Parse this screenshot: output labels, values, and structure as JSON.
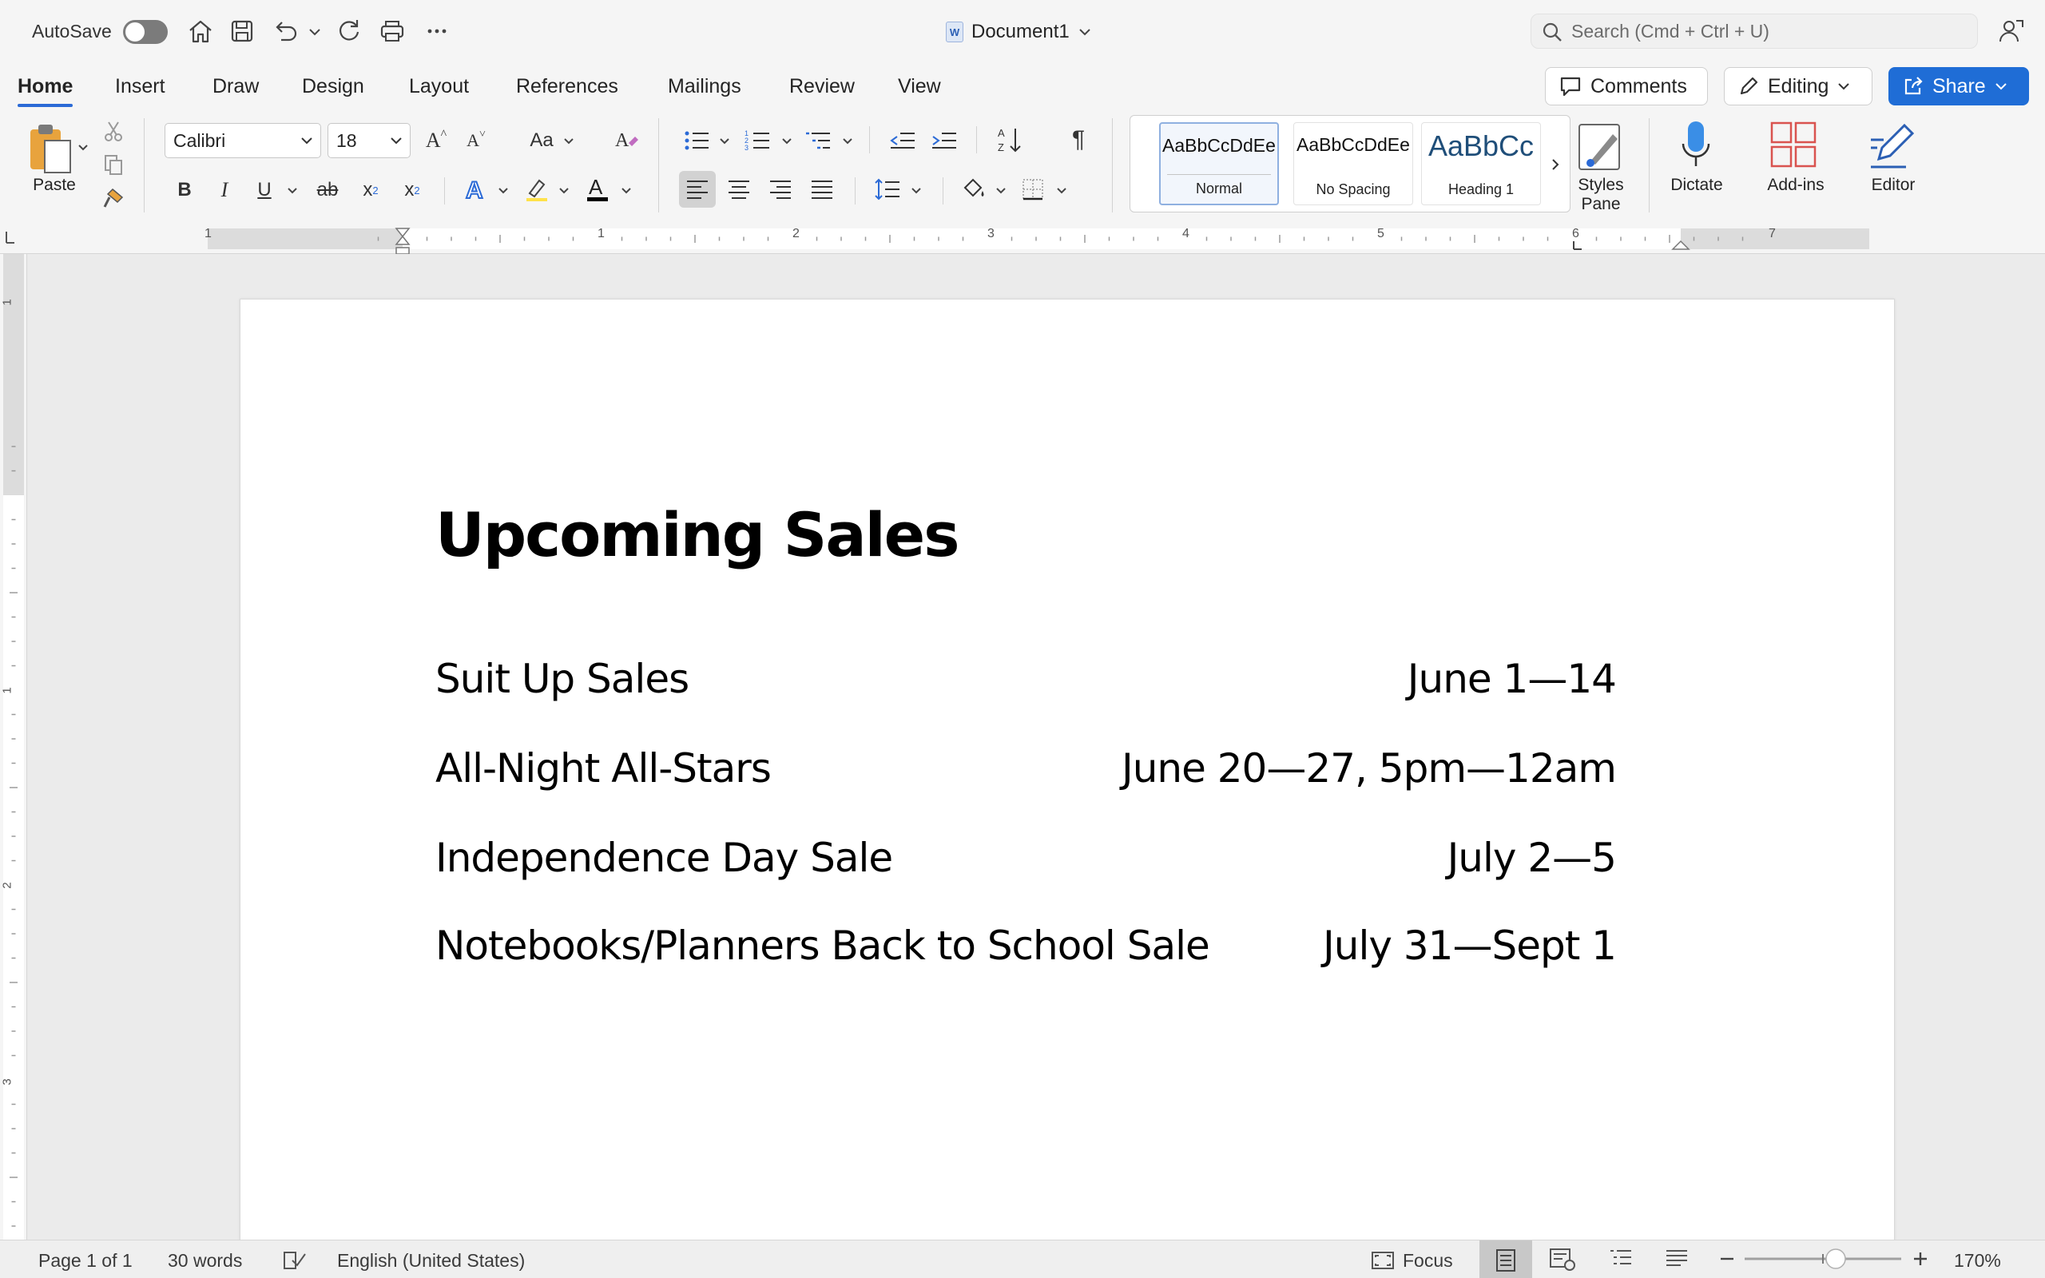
{
  "titlebar": {
    "autosave_label": "AutoSave",
    "document_name": "Document1",
    "search_placeholder": "Search (Cmd + Ctrl + U)"
  },
  "tabs": [
    "Home",
    "Insert",
    "Draw",
    "Design",
    "Layout",
    "References",
    "Mailings",
    "Review",
    "View"
  ],
  "active_tab": "Home",
  "actions": {
    "comments": "Comments",
    "editing": "Editing",
    "share": "Share"
  },
  "ribbon": {
    "paste_label": "Paste",
    "font_name": "Calibri",
    "font_size": "18",
    "change_case_label": "Aa",
    "styles": [
      {
        "sample": "AaBbCcDdEe",
        "name": "Normal"
      },
      {
        "sample": "AaBbCcDdEe",
        "name": "No Spacing"
      },
      {
        "sample": "AaBbCc",
        "name": "Heading 1"
      }
    ],
    "styles_pane_label": "Styles Pane",
    "dictate_label": "Dictate",
    "addins_label": "Add-ins",
    "editor_label": "Editor"
  },
  "ruler": {
    "horizontal_numbers": [
      "1",
      "1",
      "2",
      "3",
      "4",
      "5",
      "6",
      "7"
    ],
    "vertical_numbers": [
      "1",
      "1",
      "2",
      "3"
    ]
  },
  "document": {
    "heading": "Upcoming Sales",
    "sales": [
      {
        "name": "Suit Up Sales",
        "dates": "June 1—14"
      },
      {
        "name": "All-Night All-Stars",
        "dates": "June 20—27, 5pm—12am"
      },
      {
        "name": "Independence Day Sale",
        "dates": "July 2—5"
      },
      {
        "name": "Notebooks/Planners Back to School Sale",
        "dates": "July 31—Sept 1"
      }
    ]
  },
  "statusbar": {
    "page": "Page 1 of 1",
    "words": "30 words",
    "language": "English (United States)",
    "focus": "Focus",
    "zoom": "170%"
  },
  "colors": {
    "accent": "#2b6ad6",
    "share_button": "#1f6dd6",
    "dictate_icon": "#3a8ee6",
    "addins_icon": "#d9534f",
    "editor_icon": "#2b5fb4"
  }
}
